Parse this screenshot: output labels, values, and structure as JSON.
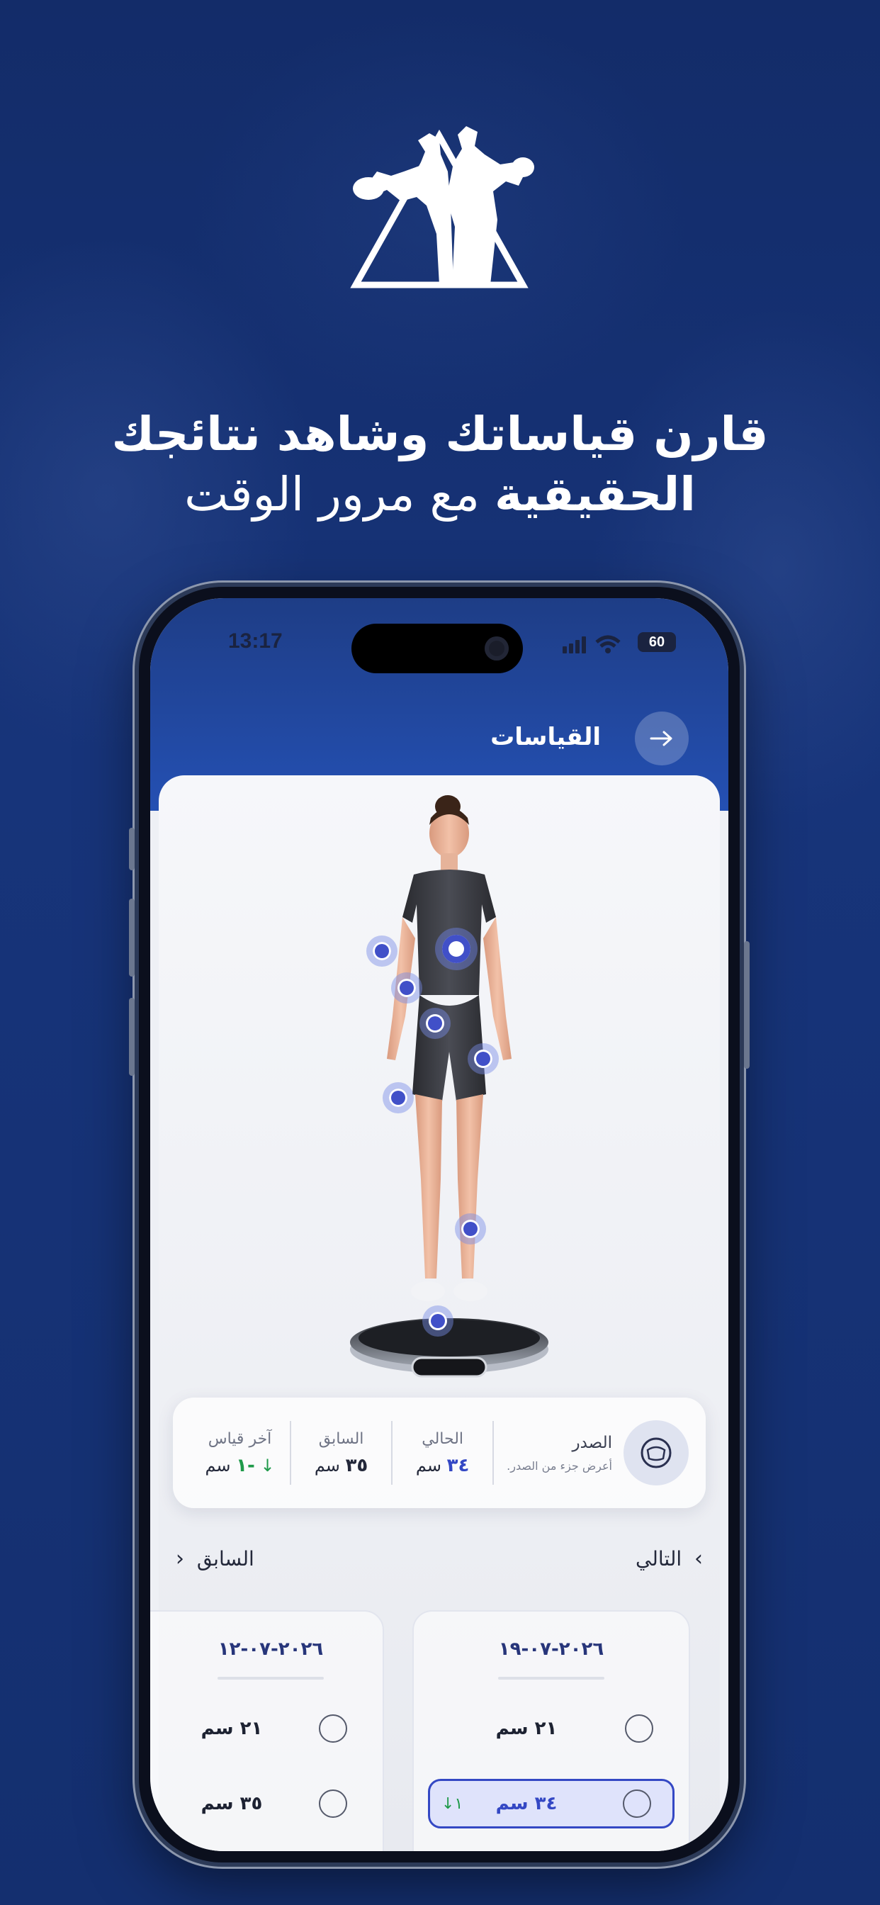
{
  "headline": {
    "line1": "قارن قياساتك وشاهد نتائجك",
    "line2_bold": "الحقيقية",
    "line2_rest": " مع مرور الوقت"
  },
  "status": {
    "time": "13:17",
    "battery": "60"
  },
  "nav": {
    "title": "القياسات"
  },
  "summary": {
    "part_name": "الصدر",
    "part_hint": "أعرض جزء من الصدر.",
    "current_label": "الحالي",
    "current_value": "٣٤",
    "previous_label": "السابق",
    "previous_value": "٣٥",
    "last_label": "آخر قياس",
    "last_value": "-١",
    "unit": "سم"
  },
  "pager": {
    "next": "التالي",
    "prev": "السابق"
  },
  "history": [
    {
      "date": "٢٠٢٦-٠٧-١٩",
      "rows": [
        {
          "value": "٢١ سم"
        },
        {
          "value": "٣٤ سم",
          "change": "١↓"
        }
      ]
    },
    {
      "date": "٢٠٢٦-٠٧-١٢",
      "rows": [
        {
          "value": "٢١ سم"
        },
        {
          "value": "٣٥ سم"
        }
      ]
    }
  ],
  "colors": {
    "brand": "#14306e",
    "accent": "#3448c4",
    "positive": "#1f9a4a"
  }
}
